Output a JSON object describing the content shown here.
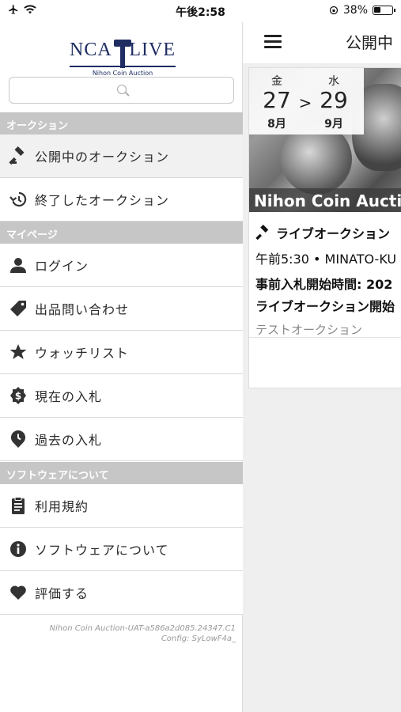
{
  "status_bar": {
    "time": "午後2:58",
    "battery": "38%",
    "battery_level": 0.38
  },
  "drawer": {
    "logo": {
      "left": "NCA",
      "right": "LIVE",
      "subtitle": "Nihon Coin Auction"
    },
    "search": {
      "placeholder": ""
    },
    "sections": [
      {
        "title": "オークション",
        "items": [
          {
            "label": "公開中のオークション",
            "icon": "gavel-icon"
          },
          {
            "label": "終了したオークション",
            "icon": "history-icon"
          }
        ]
      },
      {
        "title": "マイページ",
        "items": [
          {
            "label": "ログイン",
            "icon": "user-icon"
          },
          {
            "label": "出品問い合わせ",
            "icon": "tag-icon"
          },
          {
            "label": "ウォッチリスト",
            "icon": "star-icon"
          },
          {
            "label": "現在の入札",
            "icon": "dollar-badge-icon"
          },
          {
            "label": "過去の入札",
            "icon": "clock-badge-icon"
          }
        ]
      },
      {
        "title": "ソフトウェアについて",
        "items": [
          {
            "label": "利用規約",
            "icon": "clipboard-icon"
          },
          {
            "label": "ソフトウェアについて",
            "icon": "info-icon"
          },
          {
            "label": "評価する",
            "icon": "heart-icon"
          }
        ]
      }
    ],
    "version_line1": "Nihon Coin Auction-UAT-a586a2d085.24347.C1",
    "version_line2": "Config: SyLowF4a_"
  },
  "main": {
    "title": "公開中",
    "card": {
      "start_dow": "金",
      "start_day": "27",
      "start_month": "8月",
      "arrow": ">",
      "end_dow": "水",
      "end_day": "29",
      "end_month": "9月",
      "caption": "Nihon Coin Auctio",
      "type_label": "ライブオークション",
      "time_location": "午前5:30 • MINATO-KU",
      "prebid": "事前入札開始時間: 202",
      "live_start": "ライブオークション開始",
      "auction_name": "テストオークション"
    }
  }
}
